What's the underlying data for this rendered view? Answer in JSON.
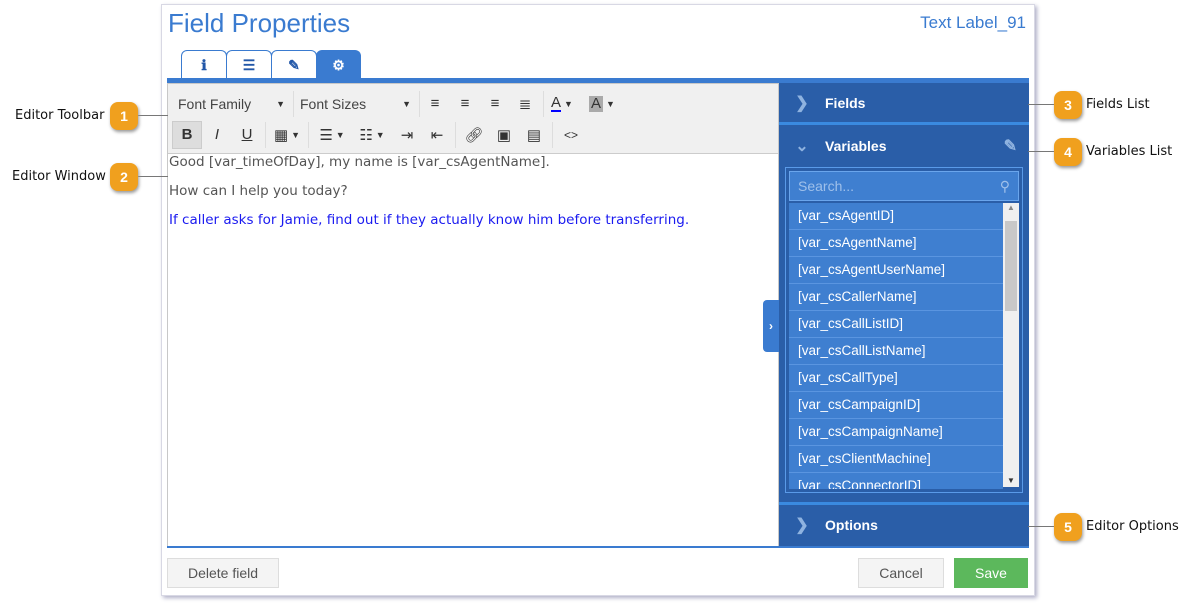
{
  "dialog": {
    "title": "Field Properties",
    "field_name": "Text Label_91"
  },
  "tabs": [
    {
      "icon": "info-icon",
      "glyph": "ℹ"
    },
    {
      "icon": "list-icon",
      "glyph": "☰"
    },
    {
      "icon": "eyedropper-icon",
      "glyph": "✎"
    },
    {
      "icon": "gear-icon",
      "glyph": "⚙",
      "active": true
    }
  ],
  "toolbar": {
    "font_family": "Font Family",
    "font_sizes": "Font Sizes",
    "bold": "B",
    "italic": "I",
    "underline": "U",
    "text_color": "A",
    "bg_color": "A",
    "code": "<>"
  },
  "editor": {
    "lines": [
      "Good [var_timeOfDay], my name is [var_csAgentName].",
      "How can I help you today?",
      "If caller asks for Jamie, find out if they actually know him before transferring."
    ]
  },
  "panel": {
    "fields": "Fields",
    "variables": "Variables",
    "options": "Options",
    "search_placeholder": "Search...",
    "variables_list": [
      "[var_csAgentID]",
      "[var_csAgentName]",
      "[var_csAgentUserName]",
      "[var_csCallerName]",
      "[var_csCallListID]",
      "[var_csCallListName]",
      "[var_csCallType]",
      "[var_csCampaignID]",
      "[var_csCampaignName]",
      "[var_csClientMachine]",
      "[var_csConnectorID]"
    ]
  },
  "footer": {
    "delete": "Delete field",
    "cancel": "Cancel",
    "save": "Save"
  },
  "callouts": [
    {
      "num": "1",
      "label": "Editor Toolbar"
    },
    {
      "num": "2",
      "label": "Editor Window"
    },
    {
      "num": "3",
      "label": "Fields List"
    },
    {
      "num": "4",
      "label": "Variables List"
    },
    {
      "num": "5",
      "label": "Editor Options"
    }
  ],
  "colors": {
    "accent": "#3a7bd0",
    "panel": "#2a5ea8",
    "save": "#5cb85c",
    "badge": "#f0a01e"
  }
}
